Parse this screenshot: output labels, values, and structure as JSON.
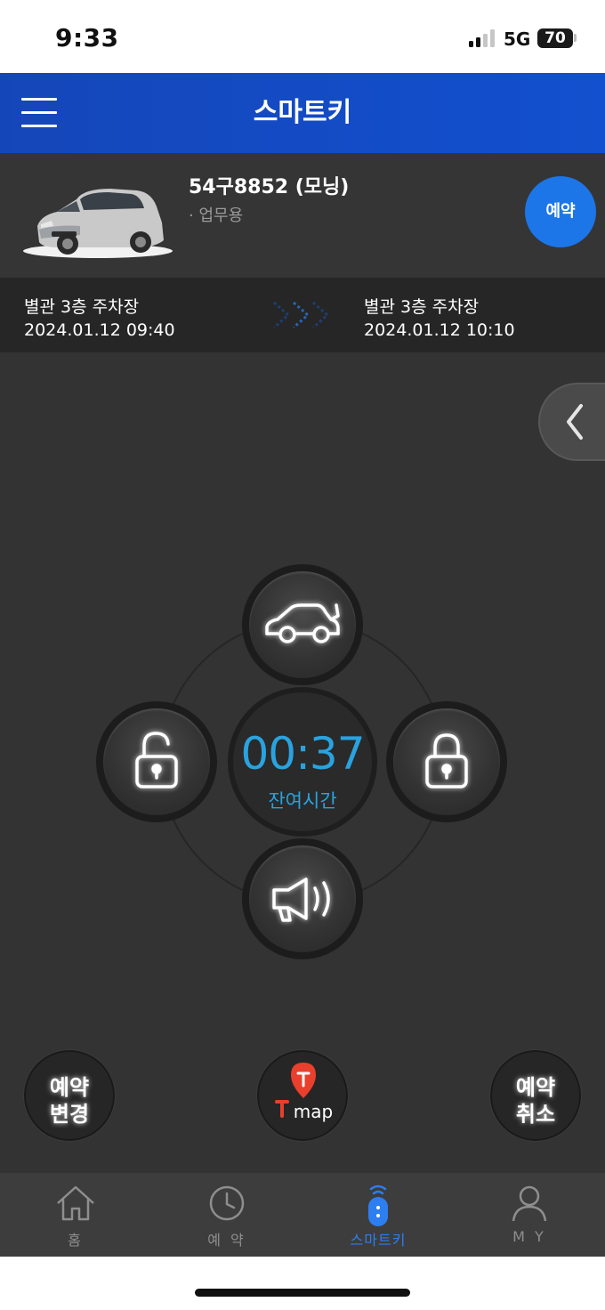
{
  "status_bar": {
    "time": "9:33",
    "network": "5G",
    "battery": "70"
  },
  "header": {
    "title": "스마트키"
  },
  "car": {
    "name": "54구8852 (모닝)",
    "usage": "· 업무용",
    "reserve_label": "예약"
  },
  "route": {
    "from": {
      "location": "별관 3층 주차장",
      "time": "2024.01.12 09:40"
    },
    "to": {
      "location": "별관 3층 주차장",
      "time": "2024.01.12 10:10"
    }
  },
  "controls": {
    "timer_value": "00:37",
    "timer_label": "잔여시간"
  },
  "actions": {
    "change": {
      "line1": "예약",
      "line2": "변경"
    },
    "tmap": {
      "label": "map"
    },
    "cancel": {
      "line1": "예약",
      "line2": "취소"
    }
  },
  "nav": {
    "items": [
      {
        "label": "홈"
      },
      {
        "label": "예 약"
      },
      {
        "label": "스마트키"
      },
      {
        "label": "M Y"
      }
    ],
    "active_color": "#2d7ef0"
  },
  "colors": {
    "brand": "#1250cf",
    "accent": "#29a3e0",
    "reserve_button": "#1c76e8"
  }
}
